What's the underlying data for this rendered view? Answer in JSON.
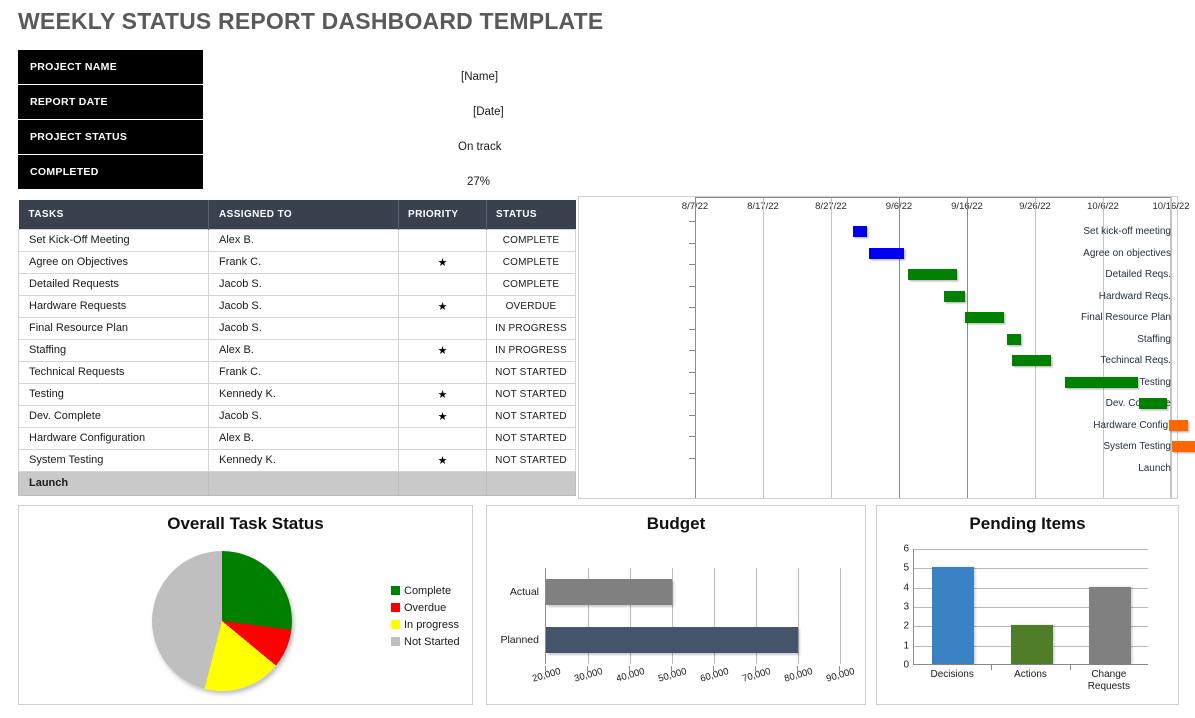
{
  "header": {
    "title": "WEEKLY STATUS REPORT DASHBOARD TEMPLATE"
  },
  "info": {
    "rows": [
      {
        "label": "PROJECT NAME",
        "value": "[Name]"
      },
      {
        "label": "REPORT DATE",
        "value": "[Date]"
      },
      {
        "label": "PROJECT STATUS",
        "value": "On track"
      },
      {
        "label": "COMPLETED",
        "value": "27%"
      }
    ]
  },
  "task_table": {
    "columns": [
      "TASKS",
      "ASSIGNED TO",
      "PRIORITY",
      "STATUS"
    ],
    "priority_glyph": "★",
    "rows": [
      {
        "task": "Set Kick-Off Meeting",
        "assigned": "Alex B.",
        "priority": "",
        "status": "COMPLETE",
        "status_class": "st-complete"
      },
      {
        "task": "Agree on Objectives",
        "assigned": "Frank C.",
        "priority": "★",
        "status": "COMPLETE",
        "status_class": "st-complete"
      },
      {
        "task": "Detailed Requests",
        "assigned": "Jacob S.",
        "priority": "",
        "status": "COMPLETE",
        "status_class": "st-complete"
      },
      {
        "task": "Hardware Requests",
        "assigned": "Jacob S.",
        "priority": "★",
        "status": "OVERDUE",
        "status_class": "st-overdue"
      },
      {
        "task": "Final Resource Plan",
        "assigned": "Jacob S.",
        "priority": "",
        "status": "IN PROGRESS",
        "status_class": "st-inprog"
      },
      {
        "task": "Staffing",
        "assigned": "Alex B.",
        "priority": "★",
        "status": "IN PROGRESS",
        "status_class": "st-inprog"
      },
      {
        "task": "Technical Requests",
        "assigned": "Frank C.",
        "priority": "",
        "status": "NOT STARTED",
        "status_class": "st-notstart"
      },
      {
        "task": "Testing",
        "assigned": "Kennedy K.",
        "priority": "★",
        "status": "NOT STARTED",
        "status_class": "st-notstart"
      },
      {
        "task": "Dev. Complete",
        "assigned": "Jacob S.",
        "priority": "★",
        "status": "NOT STARTED",
        "status_class": "st-notstart"
      },
      {
        "task": "Hardware Configuration",
        "assigned": "Alex B.",
        "priority": "",
        "status": "NOT STARTED",
        "status_class": "st-notstart"
      },
      {
        "task": "System Testing",
        "assigned": "Kennedy K.",
        "priority": "★",
        "status": "NOT STARTED",
        "status_class": "st-notstart"
      }
    ],
    "footer_row": {
      "task": "Launch",
      "assigned": "",
      "priority": "",
      "status": ""
    }
  },
  "chart_data": [
    {
      "id": "gantt",
      "type": "bar",
      "title": "",
      "orientation": "horizontal-timeline",
      "xlabel": "",
      "ylabel": "",
      "axis_ticks": [
        "8/7/22",
        "8/17/22",
        "8/27/22",
        "9/6/22",
        "9/16/22",
        "9/26/22",
        "10/6/22",
        "10/16/22"
      ],
      "axis_start": "8/7/22",
      "axis_end": "10/16/22",
      "tick_interval_days": 10,
      "grid": true,
      "colors": {
        "blue": "#0000EE",
        "green": "#008000",
        "orange": "#FF6600"
      },
      "categories": [
        "Set kick-off meeting",
        "Agree on objectives",
        "Detailed Reqs.",
        "Hardward Reqs.",
        "Final Resource Plan",
        "Staffing",
        "Techincal Reqs.",
        "Testing",
        "Dev. Complete",
        "Hardware Config.",
        "System Testing",
        "Launch"
      ],
      "bars": [
        {
          "label": "Set kick-off meeting",
          "start_pct": 33.0,
          "width_pct": 2.9,
          "color": "#0000EE"
        },
        {
          "label": "Agree on objectives",
          "start_pct": 36.3,
          "width_pct": 7.4,
          "color": "#0000EE"
        },
        {
          "label": "Detailed Reqs.",
          "start_pct": 44.5,
          "width_pct": 10.3,
          "color": "#008000"
        },
        {
          "label": "Hardward Reqs.",
          "start_pct": 52.1,
          "width_pct": 4.4,
          "color": "#008000"
        },
        {
          "label": "Final Resource Plan",
          "start_pct": 56.6,
          "width_pct": 8.1,
          "color": "#008000"
        },
        {
          "label": "Staffing",
          "start_pct": 65.3,
          "width_pct": 2.9,
          "color": "#008000"
        },
        {
          "label": "Techincal Reqs.",
          "start_pct": 66.4,
          "width_pct": 8.1,
          "color": "#008000"
        },
        {
          "label": "Testing",
          "start_pct": 77.5,
          "width_pct": 15.4,
          "color": "#008000"
        },
        {
          "label": "Dev. Complete",
          "start_pct": 93.0,
          "width_pct": 5.9,
          "color": "#008000"
        },
        {
          "label": "Hardware Config.",
          "start_pct": 99.3,
          "width_pct": 4.0,
          "color": "#FF6600"
        },
        {
          "label": "System Testing",
          "start_pct": 100.0,
          "width_pct": 8.1,
          "color": "#FF6600"
        },
        {
          "label": "Launch",
          "start_pct": 108.5,
          "width_pct": 2.9,
          "color": "#FF6600"
        }
      ]
    },
    {
      "id": "overall-task-status",
      "type": "pie",
      "title": "Overall Task Status",
      "labels": [
        "Complete",
        "Overdue",
        "In progress",
        "Not Started"
      ],
      "values": [
        27,
        9,
        18,
        46
      ],
      "colors": [
        "#008000",
        "#FF0000",
        "#FFFF00",
        "#BFBFBF"
      ],
      "legend_position": "right"
    },
    {
      "id": "budget",
      "type": "bar",
      "orientation": "horizontal",
      "title": "Budget",
      "categories": [
        "Actual",
        "Planned"
      ],
      "values": [
        50000,
        80000
      ],
      "colors": [
        "#808080",
        "#44546A"
      ],
      "xlabel": "",
      "ylabel": "",
      "xlim": [
        20000,
        90000
      ],
      "tick_labels": [
        "20,000",
        "30,000",
        "40,000",
        "50,000",
        "60,000",
        "70,000",
        "80,000",
        "90,000"
      ],
      "grid": true
    },
    {
      "id": "pending-items",
      "type": "bar",
      "orientation": "vertical",
      "title": "Pending Items",
      "categories": [
        "Decisions",
        "Actions",
        "Change Requests"
      ],
      "values": [
        5,
        2,
        4
      ],
      "colors": [
        "#3B82C4",
        "#4F7D28",
        "#808080"
      ],
      "ylim": [
        0,
        6
      ],
      "y_ticks": [
        0,
        1,
        2,
        3,
        4,
        5,
        6
      ],
      "xlabel": "",
      "ylabel": "",
      "grid": true
    }
  ]
}
